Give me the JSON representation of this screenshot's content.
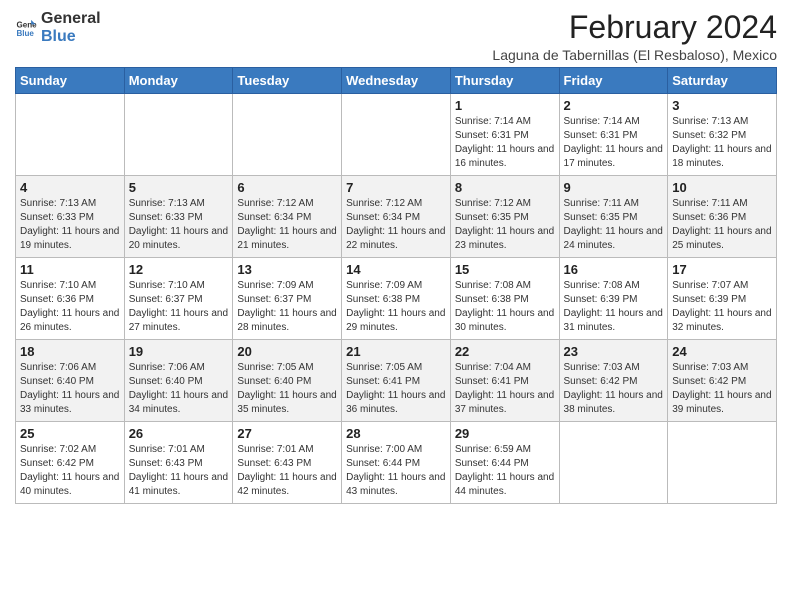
{
  "logo": {
    "general": "General",
    "blue": "Blue"
  },
  "calendar": {
    "title": "February 2024",
    "subtitle": "Laguna de Tabernillas (El Resbaloso), Mexico",
    "headers": [
      "Sunday",
      "Monday",
      "Tuesday",
      "Wednesday",
      "Thursday",
      "Friday",
      "Saturday"
    ],
    "weeks": [
      [
        {
          "day": "",
          "info": ""
        },
        {
          "day": "",
          "info": ""
        },
        {
          "day": "",
          "info": ""
        },
        {
          "day": "",
          "info": ""
        },
        {
          "day": "1",
          "info": "Sunrise: 7:14 AM\nSunset: 6:31 PM\nDaylight: 11 hours and 16 minutes."
        },
        {
          "day": "2",
          "info": "Sunrise: 7:14 AM\nSunset: 6:31 PM\nDaylight: 11 hours and 17 minutes."
        },
        {
          "day": "3",
          "info": "Sunrise: 7:13 AM\nSunset: 6:32 PM\nDaylight: 11 hours and 18 minutes."
        }
      ],
      [
        {
          "day": "4",
          "info": "Sunrise: 7:13 AM\nSunset: 6:33 PM\nDaylight: 11 hours and 19 minutes."
        },
        {
          "day": "5",
          "info": "Sunrise: 7:13 AM\nSunset: 6:33 PM\nDaylight: 11 hours and 20 minutes."
        },
        {
          "day": "6",
          "info": "Sunrise: 7:12 AM\nSunset: 6:34 PM\nDaylight: 11 hours and 21 minutes."
        },
        {
          "day": "7",
          "info": "Sunrise: 7:12 AM\nSunset: 6:34 PM\nDaylight: 11 hours and 22 minutes."
        },
        {
          "day": "8",
          "info": "Sunrise: 7:12 AM\nSunset: 6:35 PM\nDaylight: 11 hours and 23 minutes."
        },
        {
          "day": "9",
          "info": "Sunrise: 7:11 AM\nSunset: 6:35 PM\nDaylight: 11 hours and 24 minutes."
        },
        {
          "day": "10",
          "info": "Sunrise: 7:11 AM\nSunset: 6:36 PM\nDaylight: 11 hours and 25 minutes."
        }
      ],
      [
        {
          "day": "11",
          "info": "Sunrise: 7:10 AM\nSunset: 6:36 PM\nDaylight: 11 hours and 26 minutes."
        },
        {
          "day": "12",
          "info": "Sunrise: 7:10 AM\nSunset: 6:37 PM\nDaylight: 11 hours and 27 minutes."
        },
        {
          "day": "13",
          "info": "Sunrise: 7:09 AM\nSunset: 6:37 PM\nDaylight: 11 hours and 28 minutes."
        },
        {
          "day": "14",
          "info": "Sunrise: 7:09 AM\nSunset: 6:38 PM\nDaylight: 11 hours and 29 minutes."
        },
        {
          "day": "15",
          "info": "Sunrise: 7:08 AM\nSunset: 6:38 PM\nDaylight: 11 hours and 30 minutes."
        },
        {
          "day": "16",
          "info": "Sunrise: 7:08 AM\nSunset: 6:39 PM\nDaylight: 11 hours and 31 minutes."
        },
        {
          "day": "17",
          "info": "Sunrise: 7:07 AM\nSunset: 6:39 PM\nDaylight: 11 hours and 32 minutes."
        }
      ],
      [
        {
          "day": "18",
          "info": "Sunrise: 7:06 AM\nSunset: 6:40 PM\nDaylight: 11 hours and 33 minutes."
        },
        {
          "day": "19",
          "info": "Sunrise: 7:06 AM\nSunset: 6:40 PM\nDaylight: 11 hours and 34 minutes."
        },
        {
          "day": "20",
          "info": "Sunrise: 7:05 AM\nSunset: 6:40 PM\nDaylight: 11 hours and 35 minutes."
        },
        {
          "day": "21",
          "info": "Sunrise: 7:05 AM\nSunset: 6:41 PM\nDaylight: 11 hours and 36 minutes."
        },
        {
          "day": "22",
          "info": "Sunrise: 7:04 AM\nSunset: 6:41 PM\nDaylight: 11 hours and 37 minutes."
        },
        {
          "day": "23",
          "info": "Sunrise: 7:03 AM\nSunset: 6:42 PM\nDaylight: 11 hours and 38 minutes."
        },
        {
          "day": "24",
          "info": "Sunrise: 7:03 AM\nSunset: 6:42 PM\nDaylight: 11 hours and 39 minutes."
        }
      ],
      [
        {
          "day": "25",
          "info": "Sunrise: 7:02 AM\nSunset: 6:42 PM\nDaylight: 11 hours and 40 minutes."
        },
        {
          "day": "26",
          "info": "Sunrise: 7:01 AM\nSunset: 6:43 PM\nDaylight: 11 hours and 41 minutes."
        },
        {
          "day": "27",
          "info": "Sunrise: 7:01 AM\nSunset: 6:43 PM\nDaylight: 11 hours and 42 minutes."
        },
        {
          "day": "28",
          "info": "Sunrise: 7:00 AM\nSunset: 6:44 PM\nDaylight: 11 hours and 43 minutes."
        },
        {
          "day": "29",
          "info": "Sunrise: 6:59 AM\nSunset: 6:44 PM\nDaylight: 11 hours and 44 minutes."
        },
        {
          "day": "",
          "info": ""
        },
        {
          "day": "",
          "info": ""
        }
      ]
    ]
  }
}
